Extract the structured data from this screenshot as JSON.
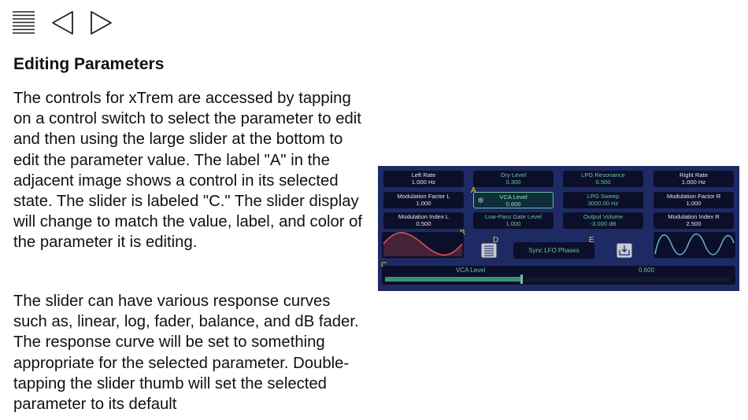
{
  "toolbar": {
    "contents_icon": "list-icon",
    "back_icon": "back-triangle-icon",
    "forward_icon": "forward-triangle-icon"
  },
  "heading": "Editing Parameters",
  "paragraphs": [
    "The controls for xTrem are accessed by tapping on a control switch to select the parameter to edit and then using the large slider at the bottom to edit the parameter value. The label \"A\" in the adjacent image shows a control in its selected state. The slider is labeled \"C.\" The slider display will change to match the value, label, and color of the parameter it is editing.",
    "The slider can have various response curves such as, linear, log, fader, balance, and dB fader. The response curve will be set to something appropriate for the selected parameter. Double-tapping the slider thumb will set the selected parameter to its default"
  ],
  "figure": {
    "controls": [
      {
        "name": "Left Rate",
        "value": "1.000 Hz"
      },
      {
        "name": "Dry Level",
        "value": "0.300"
      },
      {
        "name": "LPG Resonance",
        "value": "0.500"
      },
      {
        "name": "Right Rate",
        "value": "1.000 Hz"
      },
      {
        "name": "Modulation Factor L",
        "value": "1.000"
      },
      {
        "name": "VCA Level",
        "value": "0.600"
      },
      {
        "name": "LPG Sweep",
        "value": "3000.00 Hz"
      },
      {
        "name": "Modulation Factor R",
        "value": "1.000"
      },
      {
        "name": "Modulation Index L",
        "value": "0.500"
      },
      {
        "name": "Low-Pass Gate Level",
        "value": "1.000"
      },
      {
        "name": "Output Volume",
        "value": "-3.000 dB"
      },
      {
        "name": "Modulation Index R",
        "value": "2.500"
      }
    ],
    "markers": {
      "a": "A",
      "b": "B",
      "c": "C",
      "d": "D",
      "e": "E"
    },
    "sync_label": "Sync LFO Phases",
    "slider": {
      "name": "VCA Level",
      "value_text": "0.600",
      "value": 0.6
    },
    "colors": {
      "panel": "#1e2a63",
      "control_bg": "#0b0f2a",
      "accent_green": "#6bc1a1",
      "marker_yellow": "#f1cb3f",
      "left_wave": "#e0535f",
      "right_wave": "#6fb0d8"
    },
    "icons": {
      "presets": "list-icon",
      "save": "save-tray-icon"
    }
  }
}
